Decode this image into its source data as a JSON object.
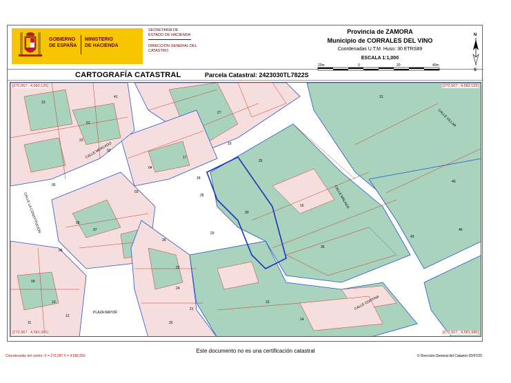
{
  "header": {
    "gobierno": "GOBIERNO\nDE ESPAÑA",
    "ministerio": "MINISTERIO\nDE HACIENDA",
    "secretaria": "SECRETARÍA DE ESTADO DE HACIENDA",
    "direccion": "DIRECCIÓN GENERAL DEL CATASTRO",
    "provincia": "Provincia de ZAMORA",
    "municipio": "Municipio de CORRALES DEL VINO",
    "coordenadas": "Coordenadas U.T.M. Huso: 30 ETRS89",
    "escala": "ESCALA 1:1,000",
    "scale_labels": [
      "20m",
      "0",
      "20",
      "40m"
    ],
    "north_n": "N",
    "north_s": "S",
    "cartografia": "CARTOGRAFÍA CATASTRAL",
    "parcela": "Parcela Catastral: 2423030TL7822S"
  },
  "map": {
    "corner_tl": "[272,067 , 4,582,125]",
    "corner_tr": "[272,507 , 4,582,125]",
    "corner_bl": "[272,067 , 4,581,985]",
    "corner_br": "[272,507 , 4,581,985]",
    "streets": [
      "CALLE MALAGA",
      "CALLE VILLAR",
      "CALLE CORTINA",
      "CALLE MERCADO",
      "CALLE LA CONSTITUCIÓN",
      "PLAZA MAYOR"
    ],
    "parcel_numbers": [
      "41",
      "31",
      "40",
      "46",
      "16",
      "30",
      "35",
      "43",
      "15",
      "14",
      "24",
      "20",
      "21",
      "28",
      "27",
      "26",
      "22",
      "23",
      "05",
      "06",
      "07",
      "08",
      "09",
      "10",
      "11",
      "12",
      "13",
      "01",
      "02",
      "03",
      "04",
      "17",
      "18",
      "19",
      "25",
      "29"
    ],
    "colors": {
      "green": "#a9d3bd",
      "pink": "#f7dede",
      "street": "#ffffff",
      "parcel_line": "#c0392b",
      "boundary": "#1a33b5",
      "block_line": "#2255cc"
    }
  },
  "footer": {
    "note": "Este documento no es una certificación catastral",
    "left": "Coordenadas del centro: X = 272,287 Y = 4,582,055",
    "right": "© Dirección General del Catastro 02/07/25"
  }
}
